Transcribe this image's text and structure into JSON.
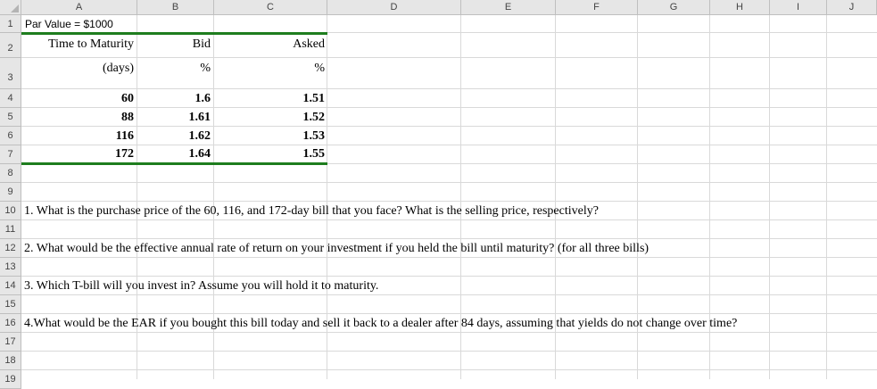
{
  "columns": [
    "A",
    "B",
    "C",
    "D",
    "E",
    "F",
    "G",
    "H",
    "I",
    "J"
  ],
  "rows": [
    "1",
    "2",
    "3",
    "4",
    "5",
    "6",
    "7",
    "8",
    "9",
    "10",
    "11",
    "12",
    "13",
    "14",
    "15",
    "16",
    "17",
    "18",
    "19"
  ],
  "cells": {
    "A1": "Par Value = $1000",
    "A2": "Time to Maturity",
    "B2": "Bid",
    "C2": "Asked",
    "A3": "(days)",
    "B3": "%",
    "C3": "%",
    "A4": "60",
    "B4": "1.6",
    "C4": "1.51",
    "A5": "88",
    "B5": "1.61",
    "C5": "1.52",
    "A6": "116",
    "B6": "1.62",
    "C6": "1.53",
    "A7": "172",
    "B7": "1.64",
    "C7": "1.55",
    "A10": "1. What is the purchase price of the 60, 116, and 172-day bill that you face? What is the selling price, respectively?",
    "A12": "2. What would be the effective annual rate of return on your investment if you held the bill until maturity? (for all three bills)",
    "A14": "3. Which T-bill will you invest in? Assume you will hold it to maturity.",
    "A16": "4.What would be the EAR if you bought this bill today and sell it back to a dealer after 84 days, assuming that yields do not change over time?"
  }
}
